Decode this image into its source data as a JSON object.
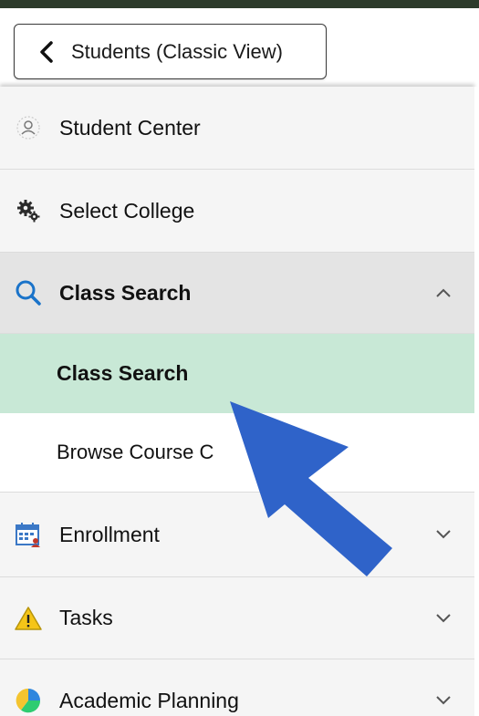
{
  "header": {
    "back_label": "Students (Classic View)"
  },
  "menu": {
    "items": [
      {
        "label": "Student Center",
        "icon": "student-center-icon"
      },
      {
        "label": "Select College",
        "icon": "gears-icon"
      },
      {
        "label": "Class Search",
        "icon": "search-icon",
        "expanded": true,
        "children": [
          {
            "label": "Class Search",
            "selected": true
          },
          {
            "label": "Browse Course C"
          }
        ]
      },
      {
        "label": "Enrollment",
        "icon": "calendar-icon"
      },
      {
        "label": "Tasks",
        "icon": "warning-icon"
      },
      {
        "label": "Academic Planning",
        "icon": "pie-chart-icon"
      }
    ]
  },
  "colors": {
    "top_bar": "#2c3a2a",
    "selected_bg": "#c8e8d6",
    "expanded_bg": "#e4e4e4",
    "search_icon": "#1a73c9",
    "annotation_arrow": "#2f63c9"
  }
}
